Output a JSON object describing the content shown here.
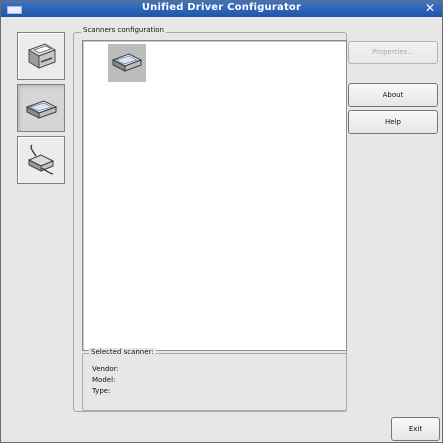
{
  "window": {
    "title": "Unified Driver Configurator",
    "close_glyph": "✕"
  },
  "sidebar": {
    "items": [
      {
        "name": "printers",
        "icon": "printer-icon",
        "active": false
      },
      {
        "name": "scanners",
        "icon": "scanner-icon",
        "active": true
      },
      {
        "name": "ports",
        "icon": "port-icon",
        "active": false
      }
    ]
  },
  "scanners_panel": {
    "group_title": "Scanners configuration",
    "items": [
      {
        "icon": "scanner-icon",
        "selected": true
      }
    ]
  },
  "selected_scanner": {
    "title": "Selected scanner:",
    "vendor_label": "Vendor:",
    "model_label": "Model:",
    "type_label": "Type:"
  },
  "buttons": {
    "properties": "Properties...",
    "about": "About",
    "help": "Help",
    "exit": "Exit"
  },
  "colors": {
    "titlebar": "#2a5fb6",
    "window_bg": "#e7e7e7",
    "selected_item_bg": "#bcbcbc"
  }
}
